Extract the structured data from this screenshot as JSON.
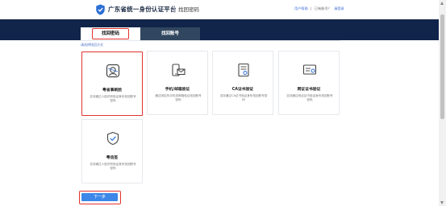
{
  "header": {
    "site_title": "广东省统一身份认证平台",
    "page_subtitle": "找回密码",
    "links": {
      "user_help": "用户帮助",
      "has_account": "已有账号？",
      "login": "请登录"
    }
  },
  "tabs": [
    {
      "label": "找回密码",
      "active": true
    },
    {
      "label": "找回账号",
      "active": false
    }
  ],
  "hint_text": "请选择找回方式",
  "cards": [
    {
      "icon": "face-recognition-icon",
      "title": "粤省事刷脸",
      "desc": "支持通过人脸识别验证身份找回账号密码",
      "selected": true
    },
    {
      "icon": "phone-email-icon",
      "title": "手机/邮箱验证",
      "desc": "通过绑定的手机或邮箱验证找回账号密码",
      "selected": false
    },
    {
      "icon": "ca-certificate-icon",
      "title": "CA证书验证",
      "desc": "支持通过CA证书验证身份找回账号密码",
      "selected": false
    },
    {
      "icon": "network-certificate-icon",
      "title": "网证证书验证",
      "desc": "支持通过网证证书验证身份找回账号密码",
      "selected": false
    },
    {
      "icon": "shield-check-icon",
      "title": "粤信签",
      "desc": "支持通过人脸识别验证身份找回账号密码",
      "selected": false
    }
  ],
  "next_button": {
    "label": "下一步"
  },
  "colors": {
    "banner": "#11254a",
    "highlight": "#e0332f",
    "button": "#3c87e8",
    "link": "#3a6bd8"
  }
}
